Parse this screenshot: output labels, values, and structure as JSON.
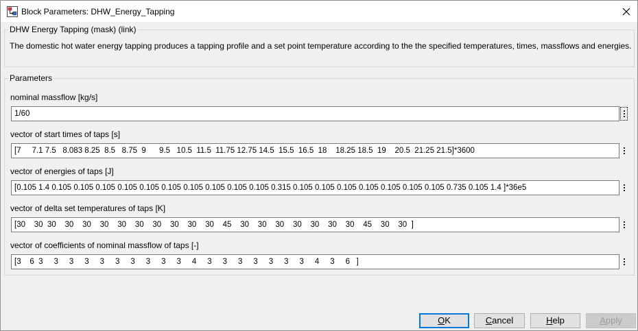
{
  "window": {
    "title": "Block Parameters: DHW_Energy_Tapping",
    "icon": "simulink-block-icon"
  },
  "mask": {
    "header": "DHW Energy Tapping (mask) (link)",
    "description": "The domestic hot water energy tapping produces a tapping profile and a set point temperature according to the the specified temperatures, times, massflows and energies."
  },
  "parameters": {
    "legend": "Parameters",
    "fields": [
      {
        "label": "nominal massflow [kg/s]",
        "value": "1/60"
      },
      {
        "label": "vector of start times of taps [s]",
        "value": "[7     7.1 7.5   8.083 8.25  8.5   8.75  9      9.5   10.5  11.5  11.75 12.75 14.5  15.5  16.5  18    18.25 18.5  19    20.5  21.25 21.5]*3600"
      },
      {
        "label": "vector of energies of taps [J]",
        "value": "[0.105 1.4 0.105 0.105 0.105 0.105 0.105 0.105 0.105 0.105 0.105 0.105 0.315 0.105 0.105 0.105 0.105 0.105 0.105 0.105 0.735 0.105 1.4 ]*36e5"
      },
      {
        "label": "vector of delta set temperatures of taps [K]",
        "value": "[30    30  30    30    30    30    30    30    30    30    30    30    45    30    30    30    30    30    30    30    45    30    30  ]"
      },
      {
        "label": "vector of coefficients of nominal massflow of taps [-]",
        "value": "[3    6  3     3     3     3     3     3     3     3     3     3     4     3     3     3     3     3     3     3     4     3     6   ]"
      }
    ]
  },
  "buttons": {
    "ok": {
      "mnemonic": "O",
      "rest": "K"
    },
    "cancel": {
      "mnemonic": "C",
      "rest": "ancel"
    },
    "help": {
      "mnemonic": "H",
      "rest": "elp"
    },
    "apply": {
      "mnemonic": "A",
      "rest": "pply"
    }
  },
  "colors": {
    "accent": "#0078d7",
    "window_bg": "#f0f0f0"
  }
}
